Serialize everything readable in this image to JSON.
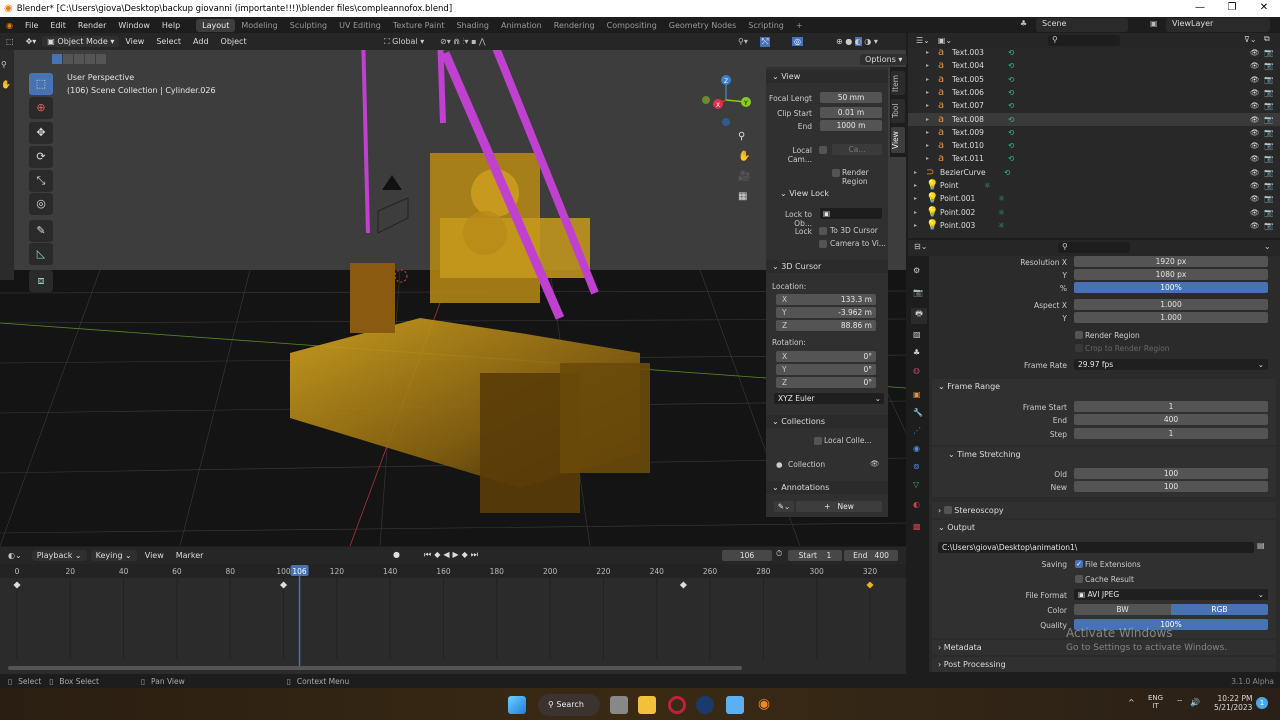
{
  "window": {
    "title": "Blender* [C:\\Users\\giova\\Desktop\\backup giovanni (importante!!!)\\blender files\\compleannofox.blend]",
    "controls": [
      "—",
      "❐",
      "✕"
    ]
  },
  "menu": {
    "items": [
      "File",
      "Edit",
      "Render",
      "Window",
      "Help"
    ],
    "workspaces": [
      "Layout",
      "Modeling",
      "Sculpting",
      "UV Editing",
      "Texture Paint",
      "Shading",
      "Animation",
      "Rendering",
      "Compositing",
      "Geometry Nodes",
      "Scripting"
    ],
    "active_workspace": "Layout",
    "add_workspace": "+",
    "scene": "Scene",
    "view_layer": "ViewLayer"
  },
  "viewport_header": {
    "mode": "Object Mode",
    "menus": [
      "View",
      "Select",
      "Add",
      "Object"
    ],
    "transform_orientation": "Global",
    "options": "Options"
  },
  "viewport": {
    "view_name": "User Perspective",
    "context": "(106) Scene Collection | Cylinder.026",
    "gizmo": {
      "x": "X",
      "y": "Y",
      "z": "Z"
    },
    "colors": {
      "gold": "#b8860b",
      "magenta": "#c040d0",
      "grid": "#101010"
    }
  },
  "npanel": {
    "tabs": [
      "Item",
      "Tool",
      "View"
    ],
    "active_tab": "View",
    "view": {
      "header": "View",
      "focal_length_label": "Focal Lengt",
      "focal_length": "50 mm",
      "clip_start_label": "Clip Start",
      "clip_start": "0.01 m",
      "end_label": "End",
      "end": "1000 m",
      "local_camera_label": "Local Cam...",
      "local_camera_value": "Ca...",
      "render_region": "Render Region"
    },
    "view_lock": {
      "header": "View Lock",
      "lock_to_object_label": "Lock to Ob...",
      "lock_label": "Lock",
      "to_3d_cursor": "To 3D Cursor",
      "camera_to_view": "Camera to Vi..."
    },
    "cursor": {
      "header": "3D Cursor",
      "location_label": "Location:",
      "x": "133.3 m",
      "y": "-3.962 m",
      "z": "88.86 m",
      "rotation_label": "Rotation:",
      "rx": "0°",
      "ry": "0°",
      "rz": "0°",
      "axis_labels": [
        "X",
        "Y",
        "Z"
      ],
      "rotation_mode": "XYZ Euler"
    },
    "collections": {
      "header": "Collections",
      "local_collections": "Local Colle...",
      "collection": "Collection"
    },
    "annotations": {
      "header": "Annotations",
      "new_button": "New"
    }
  },
  "outliner": {
    "rows": [
      {
        "name": "Text.003",
        "type": "text"
      },
      {
        "name": "Text.004",
        "type": "text"
      },
      {
        "name": "Text.005",
        "type": "text"
      },
      {
        "name": "Text.006",
        "type": "text"
      },
      {
        "name": "Text.007",
        "type": "text"
      },
      {
        "name": "Text.008",
        "type": "text",
        "selected": true
      },
      {
        "name": "Text.009",
        "type": "text"
      },
      {
        "name": "Text.010",
        "type": "text"
      },
      {
        "name": "Text.011",
        "type": "text"
      },
      {
        "name": "BezierCurve",
        "type": "curve"
      },
      {
        "name": "Point",
        "type": "light"
      },
      {
        "name": "Point.001",
        "type": "light"
      },
      {
        "name": "Point.002",
        "type": "light"
      },
      {
        "name": "Point.003",
        "type": "light"
      }
    ]
  },
  "properties": {
    "format": {
      "resolution_x_label": "Resolution X",
      "resolution_x": "1920 px",
      "y_label": "Y",
      "resolution_y": "1080 px",
      "percent_label": "%",
      "percent": "100%",
      "aspect_x_label": "Aspect X",
      "aspect_x": "1.000",
      "aspect_y": "1.000",
      "render_region": "Render Region",
      "crop_to_render_region": "Crop to Render Region",
      "frame_rate_label": "Frame Rate",
      "frame_rate": "29.97 fps"
    },
    "frame_range": {
      "header": "Frame Range",
      "start_label": "Frame Start",
      "start": "1",
      "end_label": "End",
      "end": "400",
      "step_label": "Step",
      "step": "1"
    },
    "time_stretching": {
      "header": "Time Stretching",
      "old_label": "Old",
      "old": "100",
      "new_label": "New",
      "new": "100"
    },
    "stereoscopy": {
      "header": "Stereoscopy"
    },
    "output": {
      "header": "Output",
      "path": "C:\\Users\\giova\\Desktop\\animation1\\",
      "saving_label": "Saving",
      "file_extensions": "File Extensions",
      "cache_result": "Cache Result",
      "file_format_label": "File Format",
      "file_format": "AVI JPEG",
      "color_label": "Color",
      "color_options": [
        "BW",
        "RGB"
      ],
      "color_selected": "RGB",
      "quality_label": "Quality",
      "quality": "100%"
    },
    "metadata": {
      "header": "Metadata"
    },
    "post_processing": {
      "header": "Post Processing"
    }
  },
  "timeline": {
    "menus": [
      "Playback",
      "Keying",
      "View",
      "Marker"
    ],
    "current_frame": "106",
    "start_label": "Start",
    "start": "1",
    "end_label": "End",
    "end": "400",
    "ticks": [
      "0",
      "20",
      "40",
      "60",
      "80",
      "100",
      "120",
      "140",
      "160",
      "180",
      "200",
      "220",
      "240",
      "260",
      "280",
      "300",
      "320"
    ],
    "keyframes": [
      0,
      100,
      250,
      320
    ]
  },
  "statusbar": {
    "select": "Select",
    "box_select": "Box Select",
    "pan_view": "Pan View",
    "context_menu": "Context Menu",
    "version": "3.1.0 Alpha"
  },
  "watermark": {
    "title": "Activate Windows",
    "subtitle": "Go to Settings to activate Windows."
  },
  "taskbar": {
    "search": "Search",
    "lang_top": "ENG",
    "lang_bottom": "IT",
    "time": "10:22 PM",
    "date": "5/21/2023",
    "notifications": "1"
  }
}
